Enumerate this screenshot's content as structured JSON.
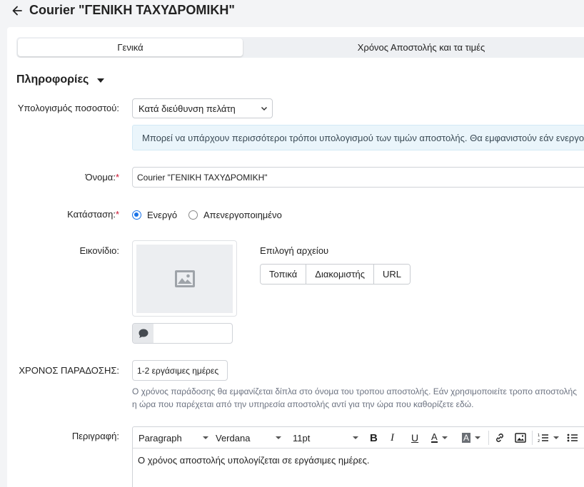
{
  "header": {
    "title": "Courier \"ΓΕΝΙΚΗ ΤΑΧΥΔΡΟΜΙΚΗ\""
  },
  "tabs": [
    {
      "label": "Γενικά",
      "active": true
    },
    {
      "label": "Χρόνος Αποστολής και τα τιμές",
      "active": false
    }
  ],
  "section": {
    "title": "Πληροφορίες"
  },
  "form": {
    "calc": {
      "label": "Υπολογισμός ποσοστού:",
      "value": "Κατά διεύθυνση πελάτη"
    },
    "info_text": "Μπορεί να υπάρχουν περισσότεροι τρόποι υπολογισμού των τιμών αποστολής. Θα εμφανιστούν εάν ενεργοποιηθούν.",
    "name": {
      "label": "Όνομα:",
      "required_mark": "*",
      "value": "Courier \"ΓΕΝΙΚΗ ΤΑΧΥΔΡΟΜΙΚΗ\""
    },
    "status": {
      "label": "Κατάσταση:",
      "required_mark": "*",
      "options": [
        "Ενεργό",
        "Απενεργοποιημένο"
      ],
      "selected": "Ενεργό"
    },
    "icon": {
      "label": "Εικονίδιο:",
      "file_label": "Επιλογή αρχείου",
      "buttons": [
        "Τοπικά",
        "Διακομιστής",
        "URL"
      ]
    },
    "delivery": {
      "label": "ΧΡΟΝΟΣ ΠΑΡΑΔΟΣΗΣ:",
      "value": "1-2 εργάσιμες ημέρες",
      "help_line1": "Ο χρόνος παράδοσης θα εμφανίζεται δίπλα στο όνομα του τροπου αποστολής. Εάν χρησιμοποιείτε τροπο αποστολής",
      "help_line2": "η ώρα που παρέχεται από την υπηρεσία αποστολής αντί για την ώρα που καθορίζετε εδώ."
    },
    "description": {
      "label": "Περιγραφή:",
      "toolbar": {
        "format": "Paragraph",
        "font": "Verdana",
        "size": "11pt"
      },
      "content": "Ο χρόνος αποστολής υπολογίζεται σε εργάσιμες ημέρες."
    }
  },
  "colors": {
    "accent": "#1a73e8",
    "required": "#c8102e",
    "info_bg": "#eaf5fb"
  }
}
